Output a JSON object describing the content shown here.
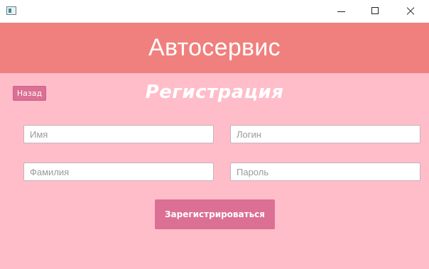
{
  "window": {
    "app_icon": "app-window-icon",
    "controls": [
      "minimize-icon",
      "maximize-icon",
      "close-icon"
    ]
  },
  "header": {
    "title": "Автосервис"
  },
  "form": {
    "back_label": "Назад",
    "heading": "Регистрация",
    "fields": {
      "name_placeholder": "Имя",
      "login_placeholder": "Логин",
      "surname_placeholder": "Фамилия",
      "password_placeholder": "Пароль"
    },
    "register_label": "Зарегистрироваться"
  },
  "colors": {
    "header_bg": "#f0807d",
    "content_bg": "#ffbdc9",
    "button_bg": "#db6f94"
  }
}
